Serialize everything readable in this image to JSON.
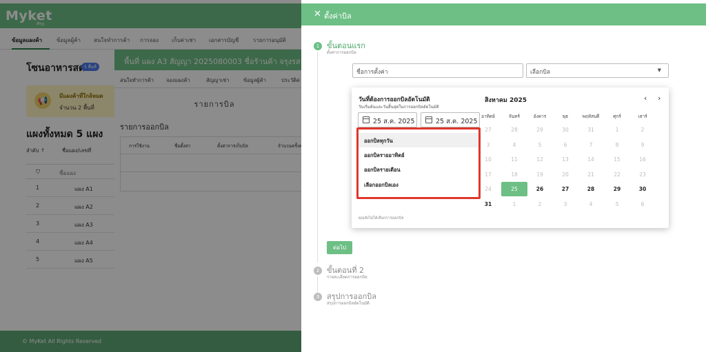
{
  "app": {
    "logo": "Myket",
    "logo_sub": "Pro",
    "nav": [
      "ข้อมูลแผงค้า",
      "ข้อมูลผู้ค้า",
      "สนใจทำการค้า",
      "การจอง",
      "เก็บค่าเช่า",
      "เอกสารบัญชี",
      "รายการอนุมัติ"
    ],
    "zone_title": "โซนอาหารสด",
    "zone_badge": "5 พื้นที่",
    "notice_line1": "มีแผงค้าที่ใกล้หมด",
    "notice_line2": "จำนวน 2 พื้นที่",
    "stalls_title": "แผงทั้งหมด 5 แผง",
    "stall_head_order": "ลำดับ ↑",
    "stall_head_name": "ชื่อแผง/เลขที่",
    "stall_filter_placeholder": "ชื่อแผง",
    "stalls": [
      {
        "no": "1",
        "name": "แผง A1"
      },
      {
        "no": "2",
        "name": "แผง A2"
      },
      {
        "no": "3",
        "name": "แผง A3"
      },
      {
        "no": "4",
        "name": "แผง A4"
      },
      {
        "no": "5",
        "name": "แผง A5"
      }
    ],
    "footer": "© MyKet All Rights Reserved"
  },
  "stall_modal": {
    "title": "พื้นที่ แผง A3 สัญญา 2025080003 ชื่อร้านค้า จรุงรส",
    "tabs": [
      "สนใจทำการค้า",
      "จองแผงค้า",
      "สัญญาเช่า",
      "ข้อมูลผู้ค้า",
      "ประวัติค่"
    ],
    "section": "รายการบิล",
    "heading": "รายการออกบิล",
    "columns": [
      "การใช้งาน",
      "ชื่อตั้งค่า",
      "ตั้งค่าการเก็บบิล",
      "จำนวนครั้งค"
    ]
  },
  "drawer": {
    "close_icon": "close-icon",
    "title": "ตั้งค่าบิล",
    "steps": [
      {
        "num": "1",
        "title": "ขั้นตอนแรก",
        "sub": "ตั้งค่าการออกบิล"
      },
      {
        "num": "2",
        "title": "ขั้นตอนที่ 2",
        "sub": "รายละเอียดการออกบิล"
      },
      {
        "num": "3",
        "title": "สรุปการออกบิล",
        "sub": "สรุปการออกบิลอัตโนมัติ"
      }
    ],
    "setting_name_placeholder": "ชื่อการตั้งค่า",
    "select_bill": "เลือกบิล",
    "next_label": "ต่อไป",
    "accent": "#6dbf85"
  },
  "popup": {
    "title": "วันที่ต้องการออกบิลอัตโนมัติ",
    "subtitle": "วันเริ่มต้นและวันสิ้นสุดในการออกบิลอัตโนมัติ",
    "start_date": "25 ส.ค. 2025",
    "end_date": "25 ส.ค. 2025",
    "presets": [
      "ออกบิลทุกวัน",
      "ออกบิลรายอาทิตย์",
      "ออกบิลรายเดือน",
      "เลือกออกบิลเอง"
    ],
    "hint": "คุณยังไม่ได้เลือกการออกบิล",
    "month": "สิงหาคม 2025",
    "prev_icon": "chevron-left-icon",
    "next_icon": "chevron-right-icon",
    "weekdays": [
      "อาทิตย์",
      "จันทร์",
      "อังคาร",
      "พุธ",
      "พฤหัสบดี",
      "ศุกร์",
      "เสาร์"
    ],
    "weeks": [
      [
        "27",
        "28",
        "29",
        "30",
        "31",
        "1",
        "2"
      ],
      [
        "3",
        "4",
        "5",
        "6",
        "7",
        "8",
        "9"
      ],
      [
        "10",
        "11",
        "12",
        "13",
        "14",
        "15",
        "16"
      ],
      [
        "17",
        "18",
        "19",
        "20",
        "21",
        "22",
        "23"
      ],
      [
        "24",
        "25",
        "26",
        "27",
        "28",
        "29",
        "30"
      ],
      [
        "31",
        "1",
        "2",
        "3",
        "4",
        "5",
        "6"
      ]
    ],
    "selected_day": "25",
    "highlight_color": "#e0362c"
  }
}
